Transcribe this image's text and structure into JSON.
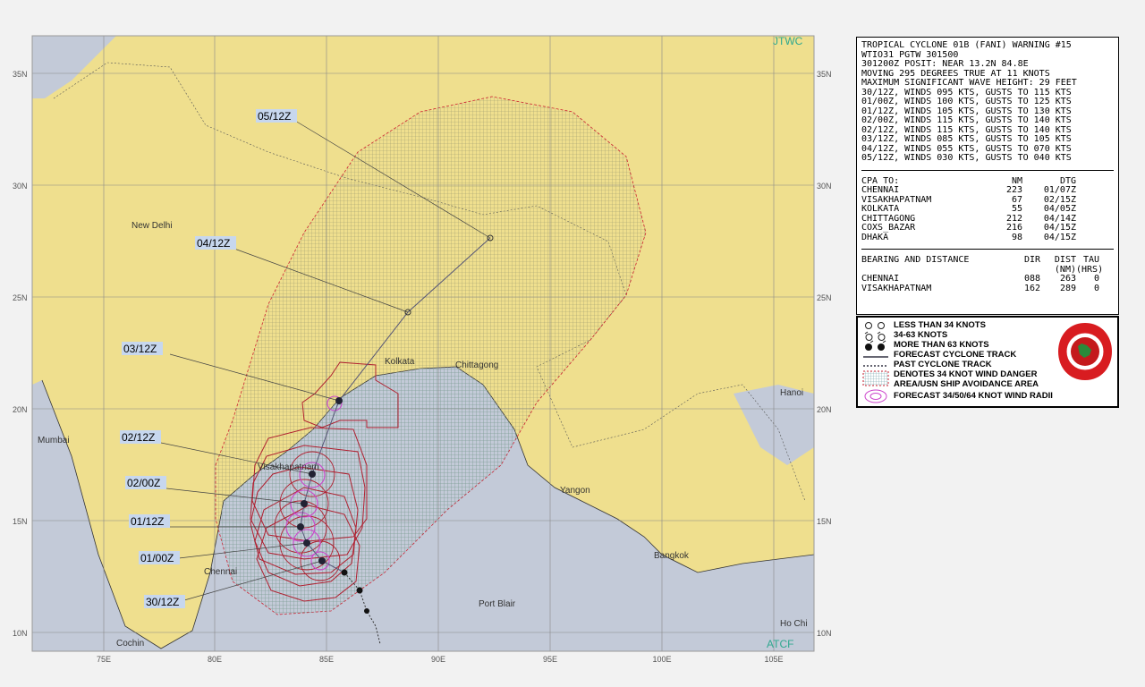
{
  "map": {
    "agency_label": "JTWC",
    "credit_label": "ATCF",
    "lat_labels": [
      "35N",
      "30N",
      "25N",
      "20N",
      "15N",
      "10N"
    ],
    "lon_labels": [
      "75E",
      "80E",
      "85E",
      "90E",
      "95E",
      "100E",
      "105E"
    ],
    "places": [
      "New Delhi",
      "Mumbai",
      "Kolkata",
      "Chittagong",
      "Hanoi",
      "Yangon",
      "Bangkok",
      "Chennai",
      "Port Blair",
      "Cochin",
      "Visakhapatnam",
      "Ho Chi"
    ],
    "forecast_times": [
      "05/12Z",
      "04/12Z",
      "03/12Z",
      "02/12Z",
      "02/00Z",
      "01/12Z",
      "01/00Z",
      "30/12Z"
    ],
    "colors": {
      "land": "#efdf8e",
      "sea": "#c3cad8",
      "danger_area": "#7ab8b8",
      "wind_radii": "#b02030",
      "forecast_34": "#cc44cc",
      "track": "#555577"
    }
  },
  "warning": {
    "header": [
      "TROPICAL CYCLONE 01B (FANI) WARNING #15",
      "WTIO31 PGTW 301500",
      "301200Z POSIT: NEAR 13.2N 84.8E",
      "MOVING 295 DEGREES TRUE AT 11 KNOTS",
      "MAXIMUM SIGNIFICANT WAVE HEIGHT: 29 FEET",
      "30/12Z, WINDS 095 KTS, GUSTS TO 115 KTS",
      "01/00Z, WINDS 100 KTS, GUSTS TO 125 KTS",
      "01/12Z, WINDS 105 KTS, GUSTS TO 130 KTS",
      "02/00Z, WINDS 115 KTS, GUSTS TO 140 KTS",
      "02/12Z, WINDS 115 KTS, GUSTS TO 140 KTS",
      "03/12Z, WINDS 085 KTS, GUSTS TO 105 KTS",
      "04/12Z, WINDS 055 KTS, GUSTS TO 070 KTS",
      "05/12Z, WINDS 030 KTS, GUSTS TO 040 KTS"
    ],
    "cpa_header": [
      "CPA TO:",
      "NM",
      "DTG"
    ],
    "cpa_rows": [
      [
        "CHENNAI",
        "223",
        "01/07Z"
      ],
      [
        "VISAKHAPATNAM",
        "67",
        "02/15Z"
      ],
      [
        "KOLKATA",
        "55",
        "04/05Z"
      ],
      [
        "CHITTAGONG",
        "212",
        "04/14Z"
      ],
      [
        "COXS_BAZAR",
        "216",
        "04/15Z"
      ],
      [
        "DHAKA",
        "98",
        "04/15Z"
      ]
    ],
    "bd_header": [
      "BEARING AND DISTANCE",
      "DIR",
      "DIST",
      "TAU"
    ],
    "bd_units": [
      "(NM)",
      "(HRS)"
    ],
    "bd_rows": [
      [
        "CHENNAI",
        "088",
        "263",
        "0"
      ],
      [
        "VISAKHAPATNAM",
        "162",
        "289",
        "0"
      ]
    ]
  },
  "legend": {
    "items": [
      "LESS THAN 34 KNOTS",
      "34-63 KNOTS",
      "MORE THAN 63 KNOTS",
      "FORECAST CYCLONE TRACK",
      "PAST CYCLONE TRACK",
      "DENOTES 34 KNOT WIND DANGER",
      "AREA/USN SHIP AVOIDANCE AREA",
      "FORECAST 34/50/64 KNOT WIND RADII"
    ]
  }
}
